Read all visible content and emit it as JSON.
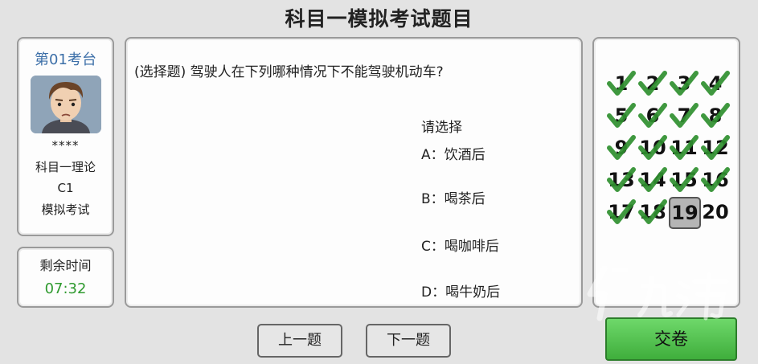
{
  "title": "科目一模拟考试题目",
  "exam_info": {
    "seat": "第01考台",
    "name": "****",
    "subject": "科目一理论",
    "license_type": "C1",
    "mode": "模拟考试"
  },
  "timer": {
    "label": "剩余时间",
    "value": "07:32"
  },
  "question": {
    "text": "(选择题) 驾驶人在下列哪种情况下不能驾驶机动车?",
    "choose_label": "请选择",
    "options": [
      "A：饮酒后",
      "B：喝茶后",
      "C：喝咖啡后",
      "D：喝牛奶后"
    ]
  },
  "answer_grid": {
    "numbers": [
      "1",
      "2",
      "3",
      "4",
      "5",
      "6",
      "7",
      "8",
      "9",
      "10",
      "11",
      "12",
      "13",
      "14",
      "15",
      "16",
      "17",
      "18",
      "19",
      "20"
    ],
    "answered": [
      true,
      true,
      true,
      true,
      true,
      true,
      true,
      true,
      true,
      true,
      true,
      true,
      true,
      true,
      true,
      true,
      true,
      true,
      false,
      false
    ],
    "current": "19"
  },
  "buttons": {
    "prev": "上一题",
    "next": "下一题",
    "submit": "交卷"
  },
  "colors": {
    "check": "#2f8f2f",
    "timer": "#2f9a2f",
    "submit": "#4cc048",
    "seat": "#3c6fa8"
  },
  "watermark": {
    "text": "九游",
    "icon": "9-logo-icon"
  }
}
